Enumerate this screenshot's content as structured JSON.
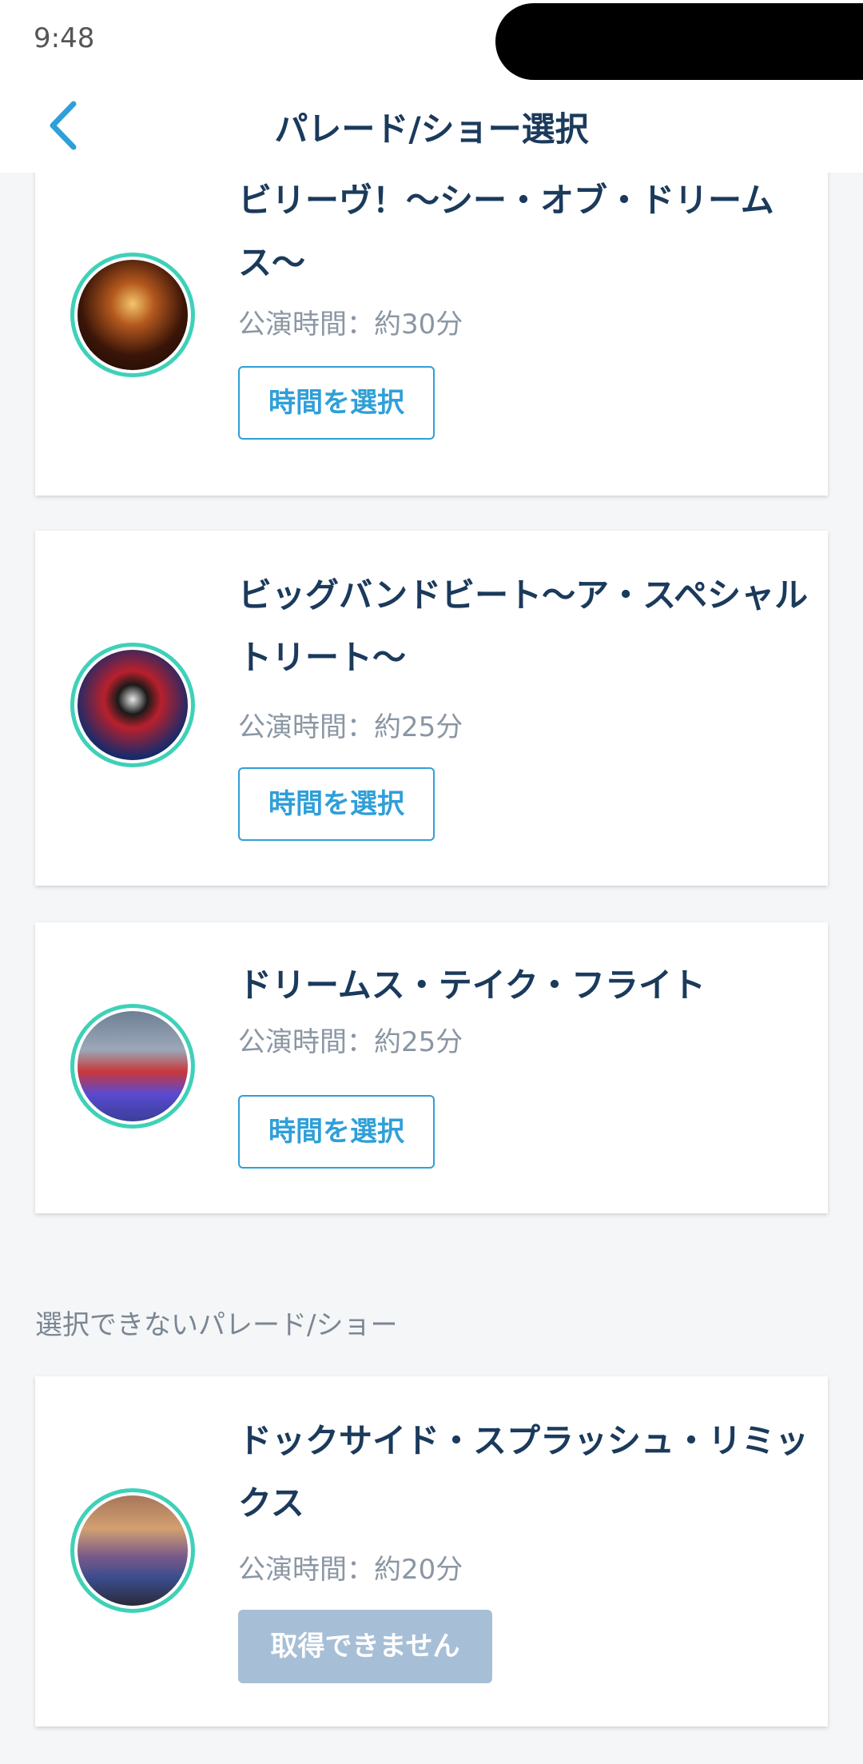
{
  "status": {
    "time": "9:48"
  },
  "header": {
    "title": "パレード/ショー選択",
    "back_icon": "chevron-left-icon"
  },
  "shows": [
    {
      "title": "ビリーヴ！〜シー・オブ・ドリームス〜",
      "duration": "公演時間：約30分",
      "button": "時間を選択"
    },
    {
      "title": "ビッグバンドビート〜ア・スペシャルトリート〜",
      "duration": "公演時間：約25分",
      "button": "時間を選択"
    },
    {
      "title": "ドリームス・テイク・フライト",
      "duration": "公演時間：約25分",
      "button": "時間を選択"
    }
  ],
  "unavailable_section": {
    "label": "選択できないパレード/ショー",
    "items": [
      {
        "title": "ドックサイド・スプラッシュ・リミックス",
        "duration": "公演時間：約20分",
        "button": "取得できません"
      }
    ]
  },
  "colors": {
    "accent": "#2f9fd8",
    "ring": "#3fd1b8",
    "title": "#1b3a5c",
    "disabled": "#a7bfd6"
  }
}
